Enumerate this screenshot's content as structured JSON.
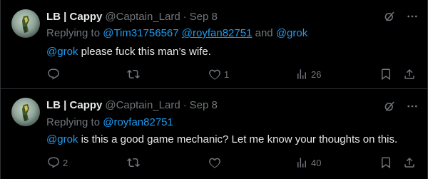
{
  "tweets": [
    {
      "author_name": "LB | Cappy",
      "handle": "@Captain_Lard",
      "separator": "·",
      "date": "Sep 8",
      "reply_prefix": "Replying to",
      "reply_mentions": [
        "@Tim31756567",
        "@royfan82751"
      ],
      "reply_and": "and",
      "reply_last": "@grok",
      "text_mention": "@grok",
      "text_body": " please fuck this man’s wife.",
      "counts": {
        "reply": "",
        "retweet": "",
        "like": "1",
        "views": "26"
      }
    },
    {
      "author_name": "LB | Cappy",
      "handle": "@Captain_Lard",
      "separator": "·",
      "date": "Sep 8",
      "reply_prefix": "Replying to",
      "reply_mentions": [
        "@royfan82751"
      ],
      "text_mention": "@grok",
      "text_body": " is this a good game mechanic? Let me know your thoughts on this.",
      "counts": {
        "reply": "2",
        "retweet": "",
        "like": "",
        "views": "40"
      }
    }
  ],
  "icons": {
    "top": [
      "grok-icon",
      "more-icon"
    ],
    "actions": [
      "reply-icon",
      "retweet-icon",
      "like-icon",
      "views-icon",
      "bookmark-icon",
      "share-icon"
    ]
  },
  "colors": {
    "background": "#000000",
    "text": "#e7e9ea",
    "muted": "#71767b",
    "link": "#1d9bf0",
    "border": "#2f3336"
  }
}
